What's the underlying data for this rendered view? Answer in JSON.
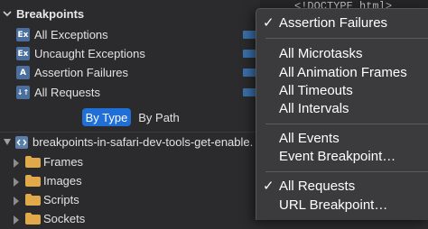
{
  "sidebar": {
    "title": "Breakpoints",
    "breakpoints": [
      {
        "icon": "Ex",
        "color": "#4a6e9e",
        "label": "All Exceptions"
      },
      {
        "icon": "Ex",
        "color": "#4a6e9e",
        "label": "Uncaught Exceptions"
      },
      {
        "icon": "A",
        "color": "#4a6e9e",
        "label": "Assertion Failures"
      },
      {
        "icon": "↓↑",
        "color": "#4a6e9e",
        "label": "All Requests"
      }
    ],
    "group_by": {
      "selected": "By Type",
      "other": "By Path"
    },
    "file": {
      "label": "breakpoints-in-safari-dev-tools-get-enable."
    },
    "tree": [
      "Frames",
      "Images",
      "Scripts",
      "Sockets"
    ]
  },
  "source": {
    "line": "<!DOCTYPE html>"
  },
  "menu": {
    "items": [
      {
        "label": "Assertion Failures",
        "checked": "✓"
      },
      {
        "label": "All Microtasks",
        "checked": ""
      },
      {
        "label": "All Animation Frames",
        "checked": ""
      },
      {
        "label": "All Timeouts",
        "checked": ""
      },
      {
        "label": "All Intervals",
        "checked": ""
      },
      {
        "label": "All Events",
        "checked": ""
      },
      {
        "label": "Event Breakpoint…",
        "checked": ""
      },
      {
        "label": "All Requests",
        "checked": "✓"
      },
      {
        "label": "URL Breakpoint…",
        "checked": ""
      }
    ]
  },
  "colors": {
    "accent": "#1f6fd6",
    "folder": "#e0a94a"
  }
}
